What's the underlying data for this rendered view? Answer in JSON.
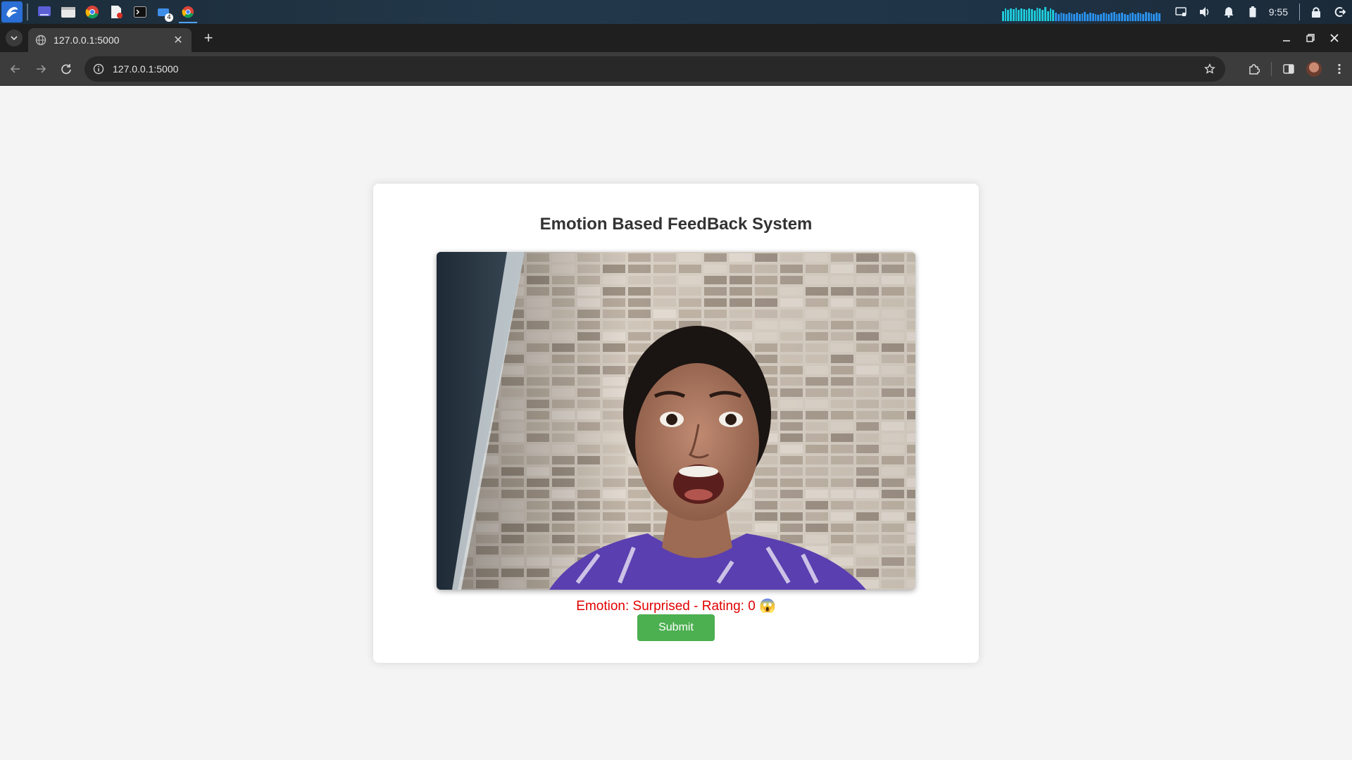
{
  "taskbar": {
    "apps": [
      {
        "icon": "launcher-icon"
      },
      {
        "icon": "desktop-icon"
      },
      {
        "icon": "files-icon"
      },
      {
        "icon": "chrome-icon"
      },
      {
        "icon": "document-icon"
      },
      {
        "icon": "terminal-icon"
      },
      {
        "icon": "windows-icon",
        "badge": "4"
      },
      {
        "icon": "chrome-icon",
        "active": true
      }
    ],
    "time": "9:55"
  },
  "browser": {
    "tab": {
      "title": "127.0.0.1:5000"
    },
    "url": "127.0.0.1:5000"
  },
  "page": {
    "title": "Emotion Based FeedBack System",
    "emotion_status": "Emotion: Surprised - Rating: 0 😱",
    "submit_label": "Submit"
  },
  "colors": {
    "status_text": "#e00000",
    "submit_button": "#4caf50",
    "page_background": "#f4f4f4"
  }
}
